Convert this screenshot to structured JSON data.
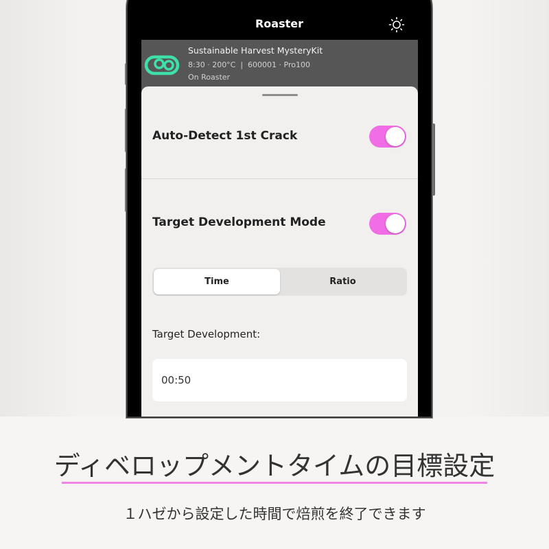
{
  "app": {
    "title": "Roaster",
    "theme_icon": "sun-icon"
  },
  "roast_card": {
    "icon": "roaster-kit-icon",
    "title": "Sustainable Harvest MysteryKit",
    "meta": "8:30 · 200°C  |  600001 · Pro100",
    "status": "On Roaster"
  },
  "settings": {
    "auto_detect": {
      "label": "Auto-Detect 1st Crack",
      "enabled": true
    },
    "target_mode": {
      "label": "Target Development Mode",
      "enabled": true
    },
    "mode_selector": {
      "options": [
        "Time",
        "Ratio"
      ],
      "selected": "Time"
    },
    "target_development": {
      "label": "Target Development:",
      "value": "00:50"
    }
  },
  "colors": {
    "accent_toggle": "#f16de6",
    "kit_icon": "#3ee0a8",
    "underline": "#ef83e6"
  },
  "caption": {
    "title": "ディベロップメントタイムの目標設定",
    "subtitle": "１ハゼから設定した時間で焙煎を終了できます"
  }
}
